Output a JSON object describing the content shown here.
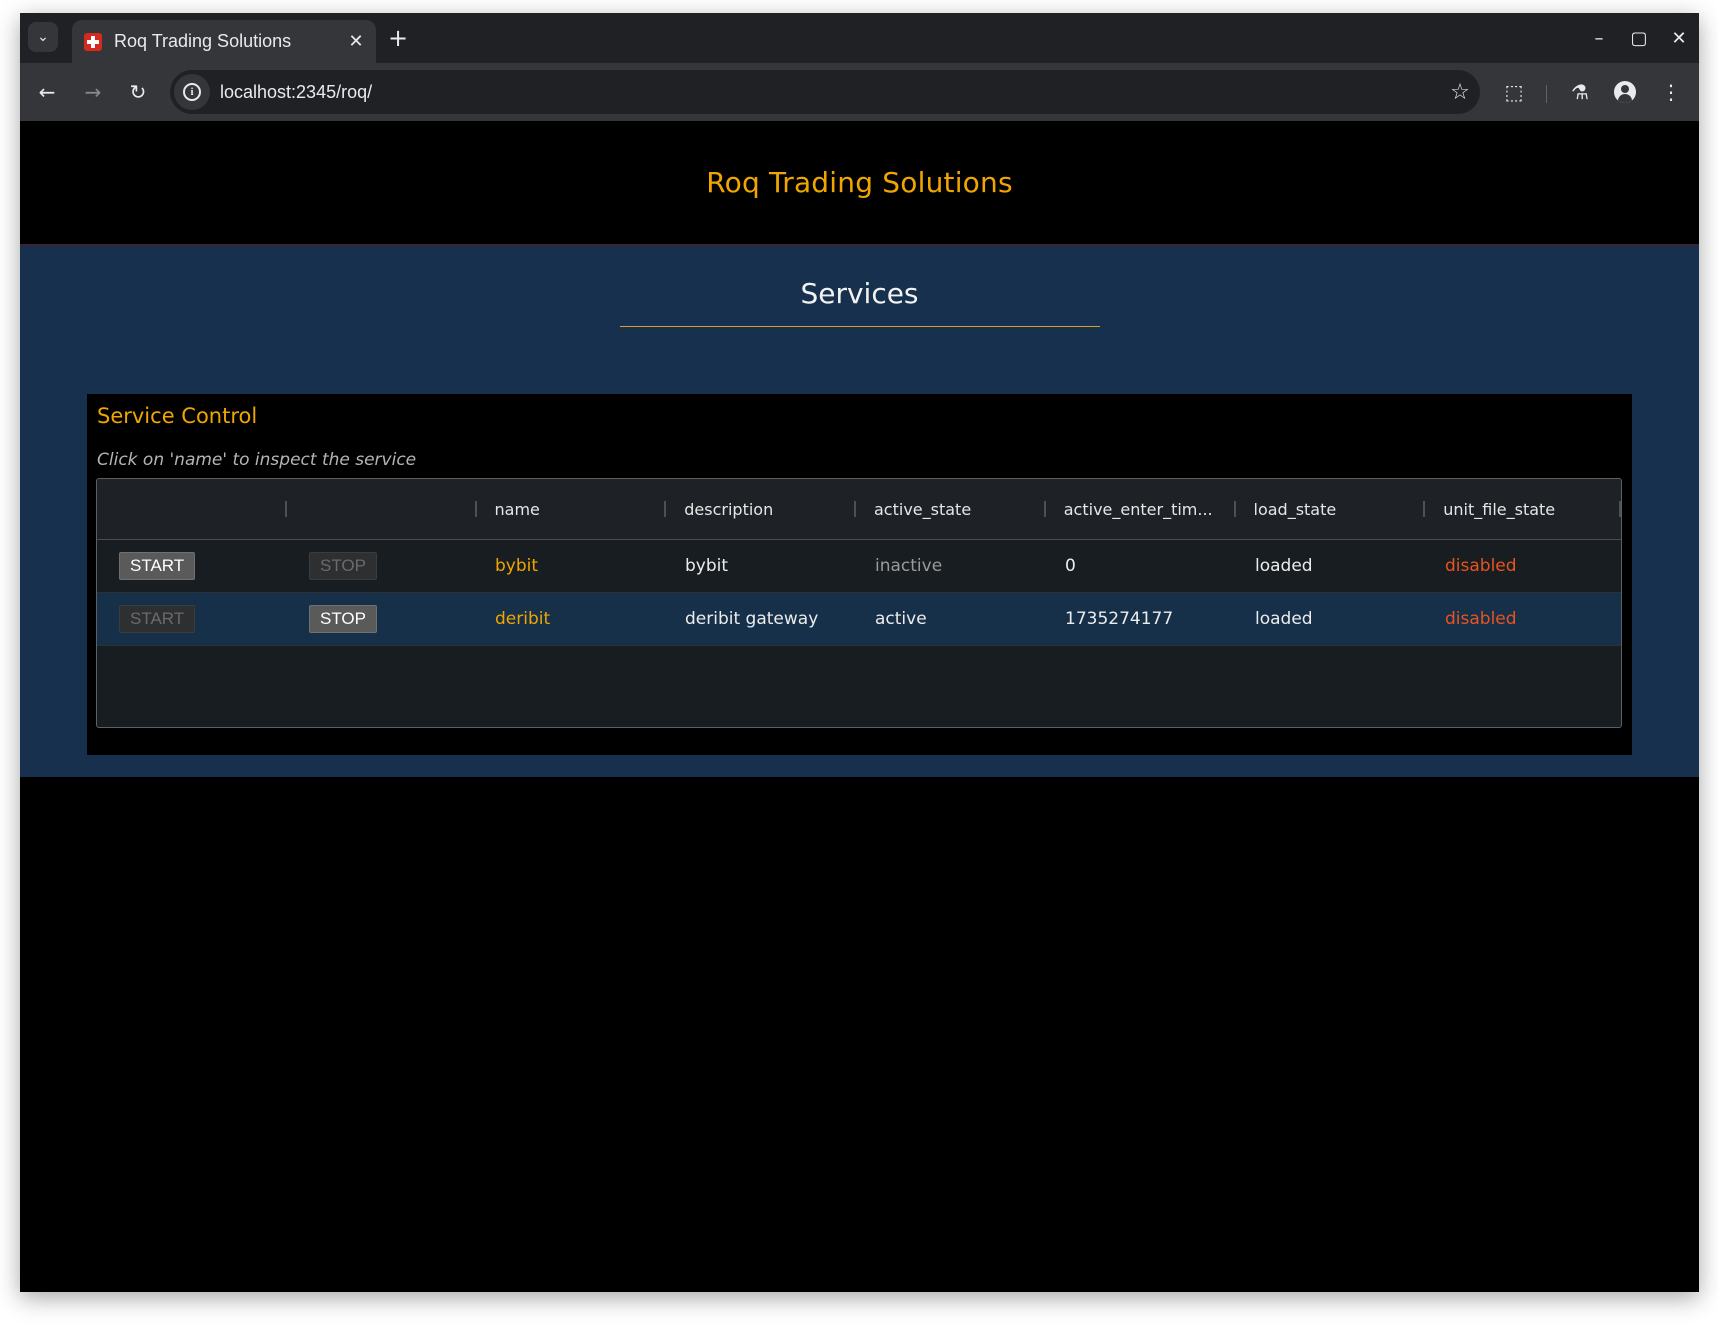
{
  "browser": {
    "tab_title": "Roq Trading Solutions",
    "url": "localhost:2345/roq/",
    "icons": {
      "tab_menu": "chevron-down-icon",
      "tab_close": "close-icon",
      "new_tab": "plus-icon",
      "minimize": "minimize-icon",
      "maximize": "maximize-icon",
      "close": "close-icon",
      "back": "back-arrow-icon",
      "forward": "forward-arrow-icon",
      "reload": "reload-icon",
      "site_info": "info-icon",
      "bookmark": "star-icon",
      "extensions": "puzzle-icon",
      "labs": "flask-icon",
      "profile": "avatar-icon",
      "menu": "kebab-menu-icon"
    }
  },
  "header": {
    "title": "Roq Trading Solutions"
  },
  "page": {
    "section_title": "Services"
  },
  "panel": {
    "title": "Service Control",
    "hint": "Click on 'name' to inspect the service"
  },
  "table": {
    "columns": [
      "",
      "",
      "name",
      "description",
      "active_state",
      "active_enter_tim...",
      "load_state",
      "unit_file_state"
    ],
    "rows": [
      {
        "start_label": "START",
        "start_enabled": true,
        "stop_label": "STOP",
        "stop_enabled": false,
        "name": "bybit",
        "description": "bybit",
        "active_state": "inactive",
        "active_enter_time": "0",
        "load_state": "loaded",
        "unit_file_state": "disabled"
      },
      {
        "start_label": "START",
        "start_enabled": false,
        "stop_label": "STOP",
        "stop_enabled": true,
        "name": "deribit",
        "description": "deribit gateway",
        "active_state": "active",
        "active_enter_time": "1735274177",
        "load_state": "loaded",
        "unit_file_state": "disabled"
      }
    ]
  },
  "colors": {
    "accent": "#f0a500",
    "content_bg": "#16304d",
    "selected_row_bg": "#17304a",
    "disabled_state": "#e8531f"
  }
}
